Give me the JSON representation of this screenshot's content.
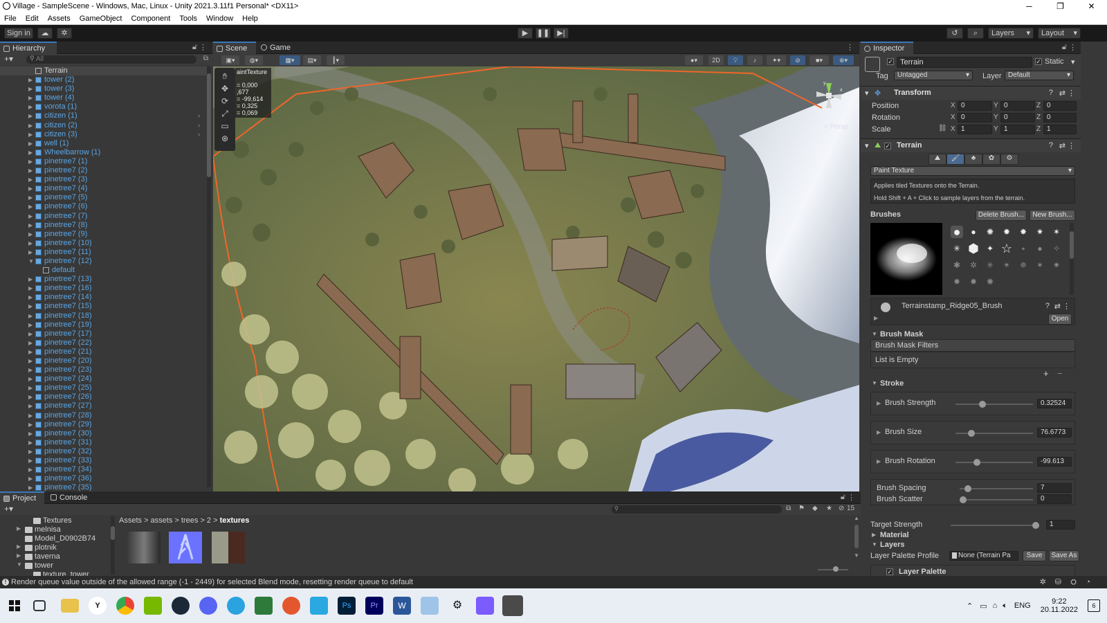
{
  "window": {
    "title": "Village - SampleScene - Windows, Mac, Linux - Unity 2021.3.11f1 Personal* <DX11>",
    "minimize": "─",
    "maximize": "❐",
    "close": "✕"
  },
  "menu": [
    "File",
    "Edit",
    "Assets",
    "GameObject",
    "Component",
    "Tools",
    "Window",
    "Help"
  ],
  "toolbar": {
    "sign_in": "Sign in",
    "layers": "Layers",
    "layout": "Layout"
  },
  "hierarchy": {
    "tab": "Hierarchy",
    "search_placeholder": "All",
    "items": [
      {
        "label": "Terrain",
        "depth": 0,
        "selected": true
      },
      {
        "label": "tower (2)"
      },
      {
        "label": "tower (3)"
      },
      {
        "label": "tower (4)"
      },
      {
        "label": "vorota (1)"
      },
      {
        "label": "citizen (1)"
      },
      {
        "label": "citizen (2)"
      },
      {
        "label": "citizen (3)"
      },
      {
        "label": "well (1)"
      },
      {
        "label": "Wheelbarrow (1)"
      },
      {
        "label": "pinetree7 (1)"
      },
      {
        "label": "pinetree7 (2)"
      },
      {
        "label": "pinetree7 (3)"
      },
      {
        "label": "pinetree7 (4)"
      },
      {
        "label": "pinetree7 (5)"
      },
      {
        "label": "pinetree7 (6)"
      },
      {
        "label": "pinetree7 (7)"
      },
      {
        "label": "pinetree7 (8)"
      },
      {
        "label": "pinetree7 (9)"
      },
      {
        "label": "pinetree7 (10)"
      },
      {
        "label": "pinetree7 (11)"
      },
      {
        "label": "pinetree7 (12)",
        "expanded": true
      },
      {
        "label": "default",
        "child": true
      },
      {
        "label": "pinetree7 (13)"
      },
      {
        "label": "pinetree7 (16)"
      },
      {
        "label": "pinetree7 (14)"
      },
      {
        "label": "pinetree7 (15)"
      },
      {
        "label": "pinetree7 (18)"
      },
      {
        "label": "pinetree7 (19)"
      },
      {
        "label": "pinetree7 (17)"
      },
      {
        "label": "pinetree7 (22)"
      },
      {
        "label": "pinetree7 (21)"
      },
      {
        "label": "pinetree7 (20)"
      },
      {
        "label": "pinetree7 (23)"
      },
      {
        "label": "pinetree7 (24)"
      },
      {
        "label": "pinetree7 (25)"
      },
      {
        "label": "pinetree7 (26)"
      },
      {
        "label": "pinetree7 (27)"
      },
      {
        "label": "pinetree7 (28)"
      },
      {
        "label": "pinetree7 (29)"
      },
      {
        "label": "pinetree7 (30)"
      },
      {
        "label": "pinetree7 (31)"
      },
      {
        "label": "pinetree7 (32)"
      },
      {
        "label": "pinetree7 (33)"
      },
      {
        "label": "pinetree7 (34)"
      },
      {
        "label": "pinetree7 (36)"
      },
      {
        "label": "pinetree7 (35)"
      }
    ]
  },
  "scene": {
    "tab_scene": "Scene",
    "tab_game": "Game",
    "mode_2d": "2D",
    "overlay_title": "aintTexture",
    "overlay_lines": [
      "= 0,000",
      ",677",
      "= -99,614",
      "= 0,325",
      "= 0,069"
    ],
    "persp_label": "< Persp",
    "gizmo_y": "y",
    "gizmo_x": "x"
  },
  "inspector": {
    "tab": "Inspector",
    "object_name": "Terrain",
    "static_label": "Static",
    "tag_label": "Tag",
    "tag_value": "Untagged",
    "layer_label": "Layer",
    "layer_value": "Default",
    "transform": {
      "title": "Transform",
      "position_label": "Position",
      "rotation_label": "Rotation",
      "scale_label": "Scale",
      "position": {
        "x": "0",
        "y": "0",
        "z": "0"
      },
      "rotation": {
        "x": "0",
        "y": "0",
        "z": "0"
      },
      "scale": {
        "x": "1",
        "y": "1",
        "z": "1"
      }
    },
    "terrain": {
      "title": "Terrain",
      "tool_dropdown": "Paint Texture",
      "help_line1": "Applies tiled Textures onto the Terrain.",
      "help_line2": "Hold Shift + A + Click to sample layers from the terrain.",
      "brushes_label": "Brushes",
      "delete_brush": "Delete Brush...",
      "new_brush": "New Brush...",
      "brush_name": "Terrainstamp_Ridge05_Brush",
      "open_button": "Open",
      "brush_mask": "Brush Mask",
      "brush_mask_filters": "Brush Mask Filters",
      "list_empty": "List is Empty",
      "plus": "+",
      "minus": "−",
      "stroke": "Stroke",
      "brush_strength_label": "Brush Strength",
      "brush_strength_value": "0.32524",
      "brush_strength_fraction": 0.33,
      "brush_size_label": "Brush Size",
      "brush_size_value": "76.6773",
      "brush_size_fraction": 0.18,
      "brush_rotation_label": "Brush Rotation",
      "brush_rotation_value": "-99.613",
      "brush_rotation_fraction": 0.25,
      "brush_spacing_label": "Brush Spacing",
      "brush_spacing_value": "7",
      "brush_spacing_fraction": 0.07,
      "brush_scatter_label": "Brush Scatter",
      "brush_scatter_value": "0",
      "brush_scatter_fraction": 0.0,
      "target_strength_label": "Target Strength",
      "target_strength_value": "1",
      "target_strength_fraction": 1.0,
      "material_label": "Material",
      "layers_label": "Layers",
      "layer_palette_profile_label": "Layer Palette Profile",
      "layer_palette_profile_value": "None (Terrain Pa",
      "save_button": "Save",
      "save_as_button": "Save As",
      "layer_palette_label": "Layer Palette"
    }
  },
  "project": {
    "tab_project": "Project",
    "tab_console": "Console",
    "hidden_count": "15",
    "folders": [
      {
        "label": "Textures",
        "indent": 1
      },
      {
        "label": "melnisa",
        "indent": 0,
        "arrow": true
      },
      {
        "label": "Model_D0902B74",
        "indent": 0
      },
      {
        "label": "plotnik",
        "indent": 0,
        "arrow": true
      },
      {
        "label": "taverna",
        "indent": 0,
        "arrow": true
      },
      {
        "label": "tower",
        "indent": 0,
        "arrow": true,
        "expanded": true
      },
      {
        "label": "texture_tower",
        "indent": 1
      }
    ],
    "breadcrumbs": [
      "Assets",
      "assets",
      "trees",
      "2",
      "textures"
    ]
  },
  "status": {
    "message": "Render queue value outside of the allowed range (-1 - 2449) for selected Blend mode, resetting render queue to default"
  },
  "taskbar": {
    "lang": "ENG",
    "time": "9:22",
    "date": "20.11.2022",
    "notif_count": "6"
  }
}
